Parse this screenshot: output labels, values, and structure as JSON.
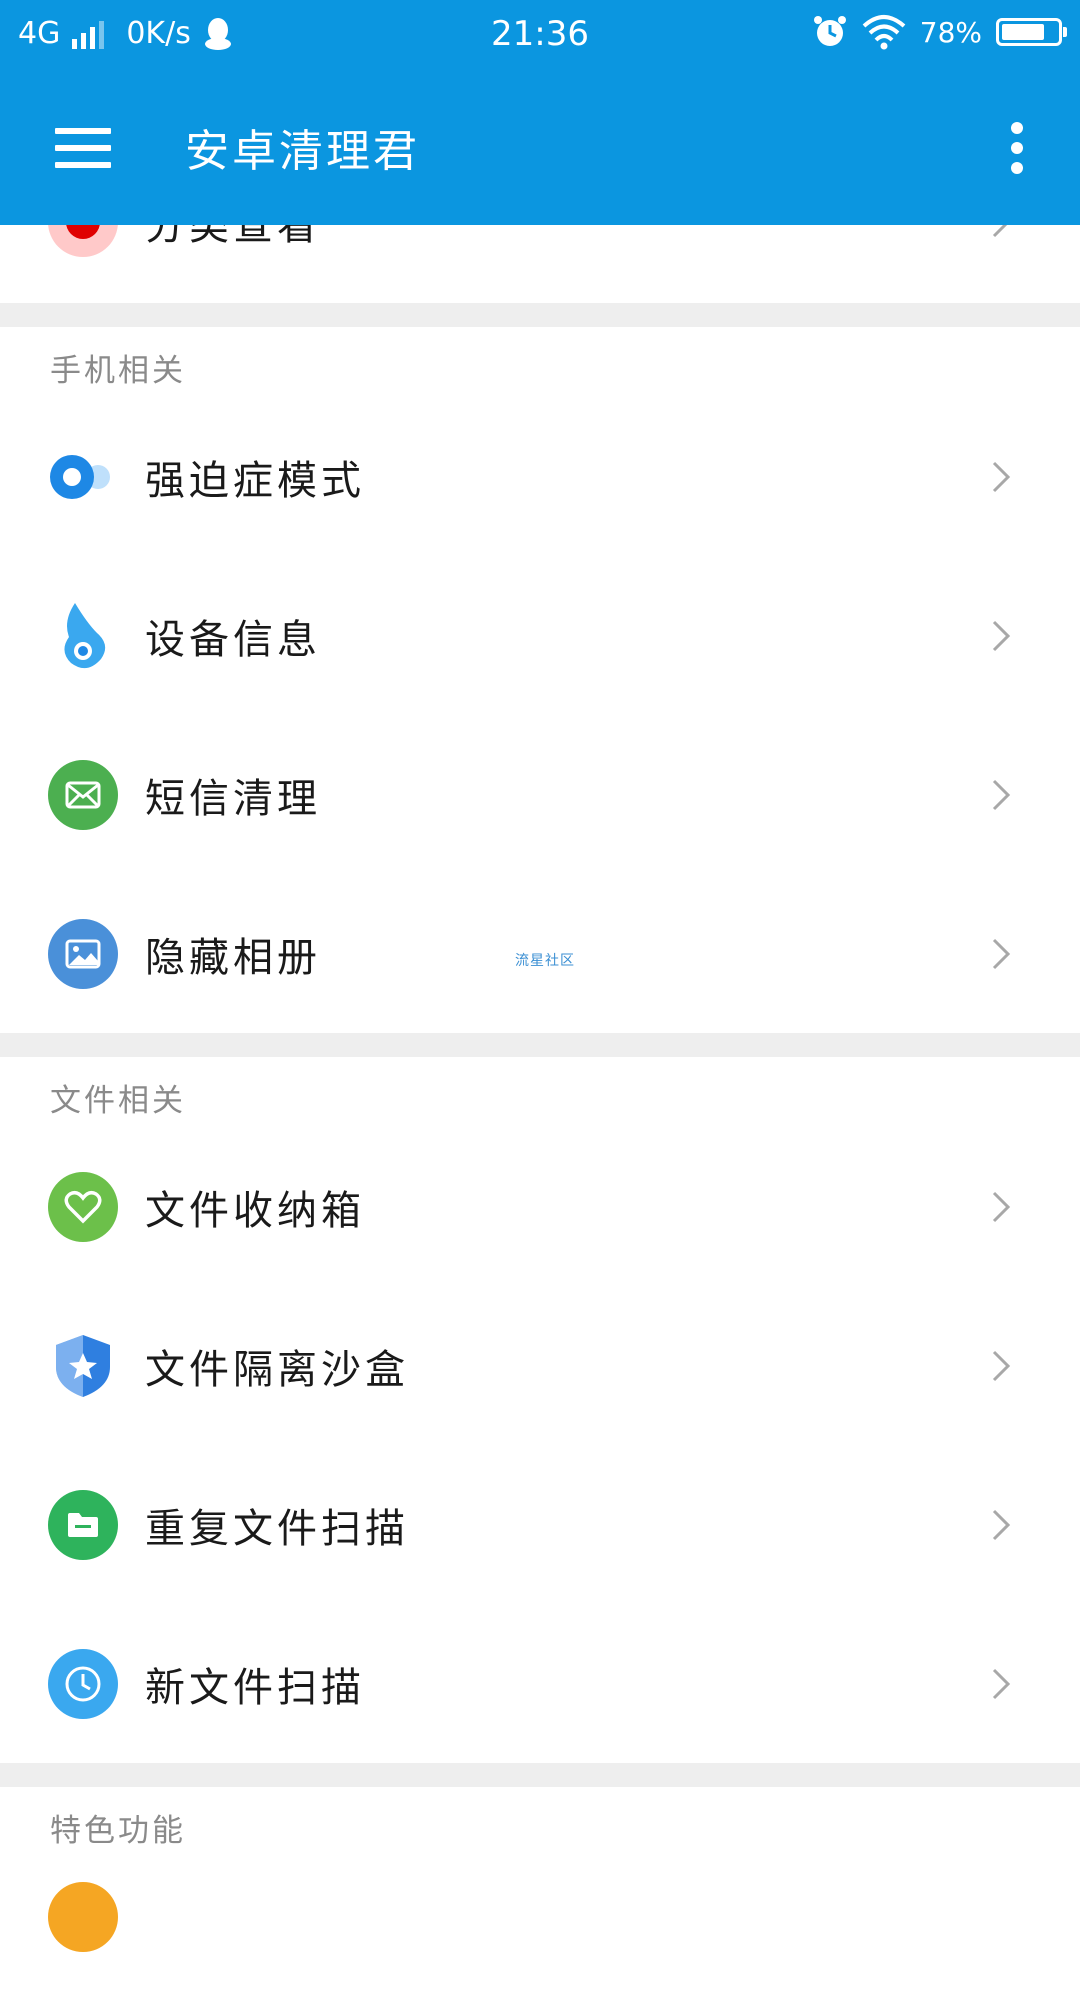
{
  "status_bar": {
    "network": "4G",
    "speed": "0K/s",
    "time": "21:36",
    "battery": "78%",
    "battery_level": 0.78
  },
  "app_bar": {
    "title": "安卓清理君"
  },
  "partial_top_row": {
    "label": "分类查看"
  },
  "sections": [
    {
      "header": "手机相关",
      "items": [
        {
          "label": "强迫症模式",
          "icon": "toggle-icon"
        },
        {
          "label": "设备信息",
          "icon": "drop-icon"
        },
        {
          "label": "短信清理",
          "icon": "mail-icon"
        },
        {
          "label": "隐藏相册",
          "icon": "image-icon"
        }
      ]
    },
    {
      "header": "文件相关",
      "items": [
        {
          "label": "文件收纳箱",
          "icon": "heart-icon"
        },
        {
          "label": "文件隔离沙盒",
          "icon": "shield-star-icon"
        },
        {
          "label": "重复文件扫描",
          "icon": "folder-icon"
        },
        {
          "label": "新文件扫描",
          "icon": "clock-icon"
        }
      ]
    },
    {
      "header": "特色功能",
      "items": []
    }
  ],
  "watermark": "流星社区",
  "colors": {
    "primary": "#0b96e0",
    "divider": "#eeeeee",
    "icon_green": "#4caf50",
    "icon_lightgreen": "#6cc04a",
    "icon_blue": "#4a90d9",
    "icon_sky": "#3aa8ef"
  }
}
